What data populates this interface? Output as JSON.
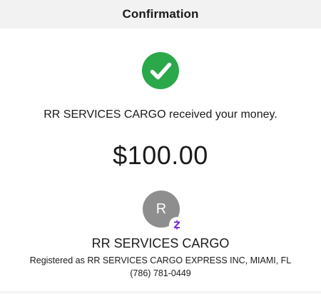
{
  "header": {
    "title": "Confirmation"
  },
  "status": {
    "icon": "check-circle-icon",
    "color": "#2aa84a"
  },
  "message": "RR SERVICES CARGO received your money.",
  "amount": "$100.00",
  "recipient": {
    "initial": "R",
    "badge_icon": "zelle-icon",
    "badge_color": "#6d1ed4",
    "name": "RR SERVICES CARGO",
    "registered": "Registered as RR SERVICES CARGO EXPRESS INC, MIAMI, FL",
    "phone": "(786) 781-0449"
  }
}
